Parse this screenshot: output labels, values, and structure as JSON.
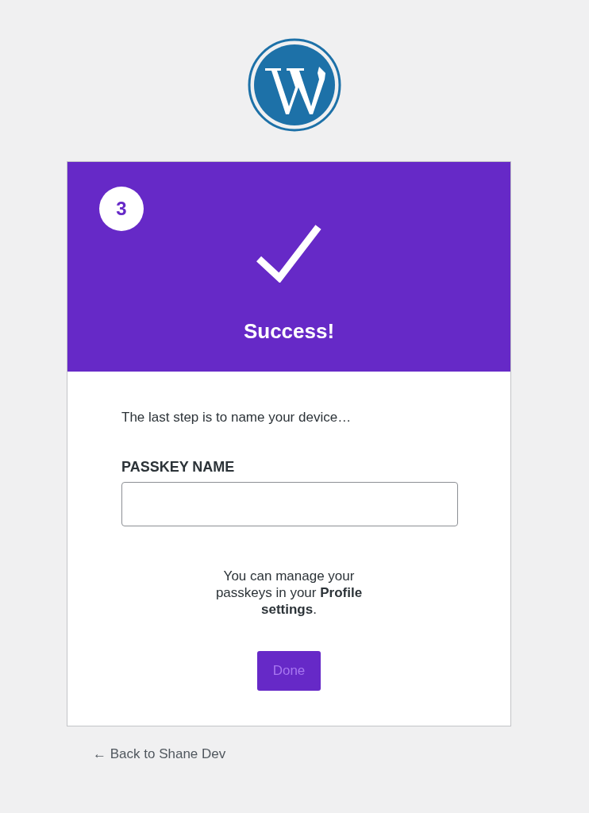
{
  "step": {
    "number": "3"
  },
  "header": {
    "title": "Success!"
  },
  "intro": "The last step is to name your device…",
  "passkey_field": {
    "label": "PASSKEY NAME"
  },
  "note": "You can manage your passkeys in your **Profile settings**.",
  "done_button": {
    "label": "Done",
    "disabled": true
  },
  "back_link": "← Back to Shane Dev"
}
